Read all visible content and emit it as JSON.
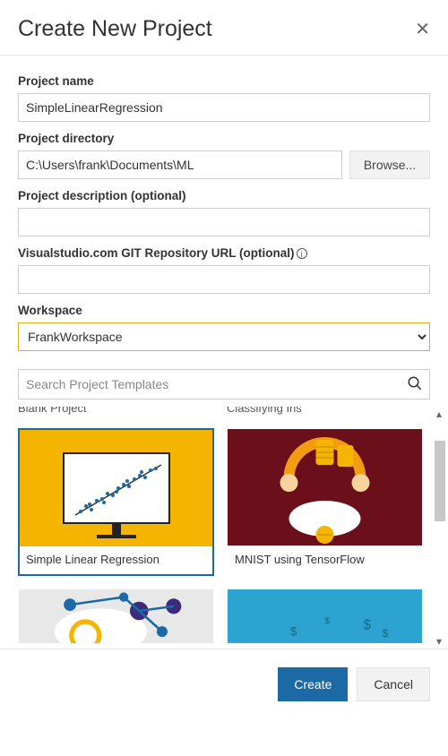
{
  "dialog": {
    "title": "Create New Project"
  },
  "fields": {
    "project_name": {
      "label": "Project name",
      "value": "SimpleLinearRegression"
    },
    "project_directory": {
      "label": "Project directory",
      "value": "C:\\Users\\frank\\Documents\\ML",
      "browse": "Browse..."
    },
    "project_description": {
      "label": "Project description (optional)",
      "value": ""
    },
    "git_url": {
      "label": "Visualstudio.com GIT Repository URL (optional)",
      "value": ""
    },
    "workspace": {
      "label": "Workspace",
      "selected": "FrankWorkspace"
    }
  },
  "search": {
    "placeholder": "Search Project Templates",
    "value": ""
  },
  "templates": {
    "cutoff_labels": [
      "Blank Project",
      "Classifying Iris"
    ],
    "visible": [
      {
        "id": "slr",
        "label": "Simple Linear Regression",
        "selected": true
      },
      {
        "id": "mnist",
        "label": "MNIST using TensorFlow",
        "selected": false
      }
    ]
  },
  "footer": {
    "create": "Create",
    "cancel": "Cancel"
  }
}
